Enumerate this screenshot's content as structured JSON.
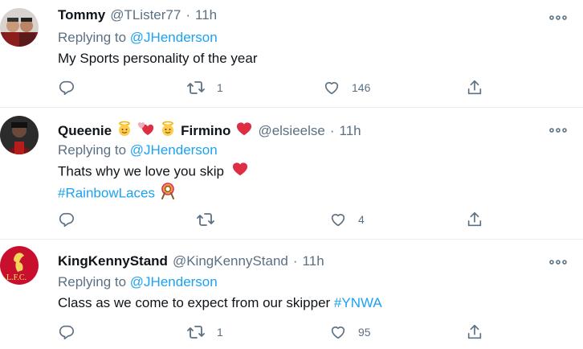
{
  "tweets": [
    {
      "name": "Tommy",
      "handle": "@TLister77",
      "separator": "·",
      "time": "11h",
      "replying_prefix": "Replying to",
      "replying_to": "@JHenderson",
      "text": "My Sports personality of the year",
      "retweets": "1",
      "likes": "146",
      "icons": [
        "reply-icon",
        "retweet-icon",
        "like-icon",
        "share-icon",
        "more-icon"
      ]
    },
    {
      "name_prefix": "Queenie",
      "name_suffix": "Firmino",
      "name_emojis": [
        "angel-emoji",
        "hearts-emoji",
        "angel-emoji",
        "red-heart-emoji"
      ],
      "handle": "@elsieelse",
      "separator": "·",
      "time": "11h",
      "replying_prefix": "Replying to",
      "replying_to": "@JHenderson",
      "text": "Thats why we love you skip",
      "hashtag": "#RainbowLaces",
      "retweets": "",
      "likes": "4"
    },
    {
      "name": "KingKennyStand",
      "handle": "@KingKennyStand",
      "separator": "·",
      "time": "11h",
      "replying_prefix": "Replying to",
      "replying_to": "@JHenderson",
      "text": "Class as we come to expect from our skipper",
      "hashtag": "#YNWA",
      "retweets": "1",
      "likes": "95"
    }
  ],
  "colors": {
    "link": "#1da1f2",
    "secondary": "#5b7083",
    "divider": "#e6ecf0",
    "heart": "#e0245e"
  }
}
